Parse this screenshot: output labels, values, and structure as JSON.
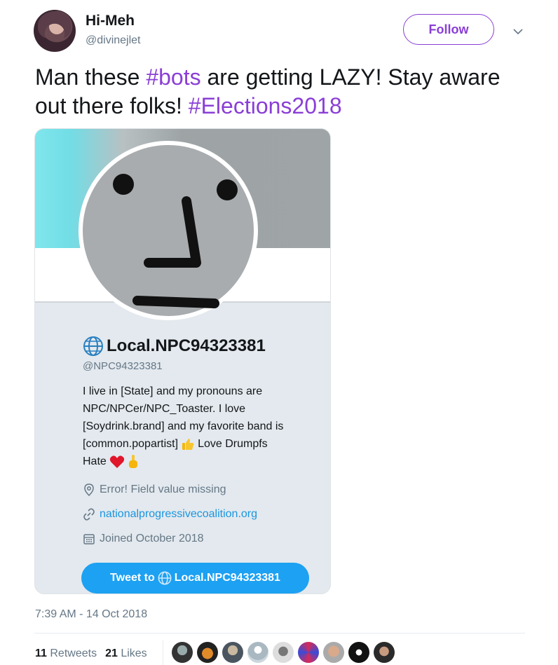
{
  "user": {
    "display_name": "Hi-Meh",
    "handle": "@divinejlet",
    "follow_label": "Follow"
  },
  "tweet": {
    "text_parts": [
      "Man these ",
      "#bots",
      " are getting LAZY! Stay aware out there folks! ",
      "#Elections2018"
    ],
    "timestamp": "7:39 AM - 14 Oct 2018"
  },
  "card": {
    "name": "Local.NPC94323381",
    "handle": "@NPC94323381",
    "bio_lines": [
      "I live in [State] and my pronouns are",
      "NPC/NPCer/NPC_Toaster. I love",
      "[Soydrink.brand] and my favorite band is",
      "[common.popartist]",
      "Love Drumpfs",
      "Hate"
    ],
    "location": "Error! Field value missing",
    "website": "nationalprogressivecoalition.org",
    "joined": "Joined October 2018",
    "tweet_to_prefix": "Tweet to",
    "tweet_to_name": "Local.NPC94323381"
  },
  "stats": {
    "retweets_count": "11",
    "retweets_label": "Retweets",
    "likes_count": "21",
    "likes_label": "Likes"
  },
  "colors": {
    "hashtag": "#8a3ed6",
    "link": "#1b95e0",
    "button": "#1da1f2"
  }
}
